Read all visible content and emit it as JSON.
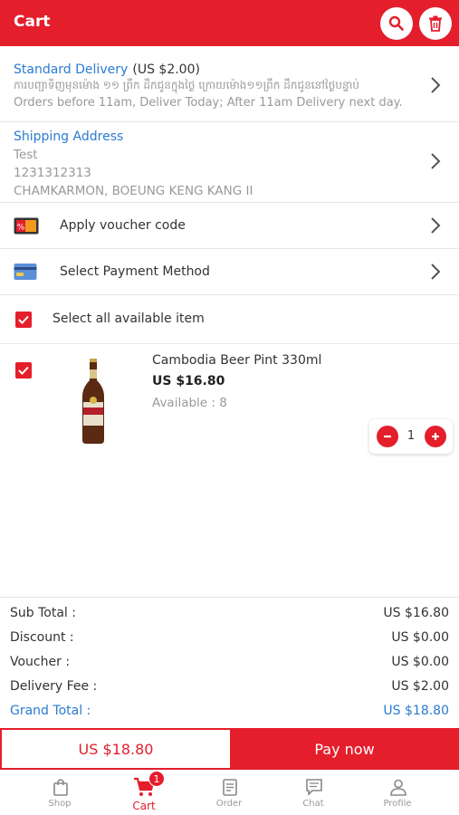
{
  "header": {
    "title": "Cart"
  },
  "delivery": {
    "title": "Standard Delivery",
    "price": "(US $2.00)",
    "khmer_note": "ការបញ្ជាទិញមុនម៉ោង ១១ ព្រឹក ដឹកជូនក្នុងថ្ងៃ ក្រោយម៉ោង១១ព្រឹក ដឹកជូននៅថ្ងៃបន្ទាប់",
    "note": "Orders before 11am, Deliver Today; After 11am Delivery next day."
  },
  "address": {
    "title": "Shipping Address",
    "name": "Test",
    "phone": "1231312313",
    "location": "CHAMKARMON, BOEUNG KENG KANG II"
  },
  "voucher": {
    "label": "Apply voucher code"
  },
  "payment": {
    "label": "Select Payment Method"
  },
  "select_all": {
    "label": "Select all available item",
    "checked": true
  },
  "items": [
    {
      "name": "Cambodia Beer Pint 330ml",
      "price": "US $16.80",
      "availability": "Available : 8",
      "quantity": "1",
      "checked": true
    }
  ],
  "summary": {
    "subtotal_label": "Sub Total :",
    "subtotal": "US $16.80",
    "discount_label": "Discount :",
    "discount": "US $0.00",
    "voucher_label": "Voucher :",
    "voucher": "US $0.00",
    "delivery_label": "Delivery Fee :",
    "delivery": "US $2.00",
    "grand_label": "Grand Total :",
    "grand": "US $18.80"
  },
  "footer": {
    "total": "US $18.80",
    "pay_label": "Pay now"
  },
  "tabs": [
    {
      "label": "Shop",
      "icon": "shop-bag-icon"
    },
    {
      "label": "Cart",
      "icon": "cart-icon",
      "badge": "1",
      "active": true
    },
    {
      "label": "Order",
      "icon": "order-list-icon"
    },
    {
      "label": "Chat",
      "icon": "chat-icon"
    },
    {
      "label": "Profile",
      "icon": "profile-icon"
    }
  ],
  "colors": {
    "brand_red": "#e41e2b",
    "link_blue": "#2a7bd1"
  }
}
